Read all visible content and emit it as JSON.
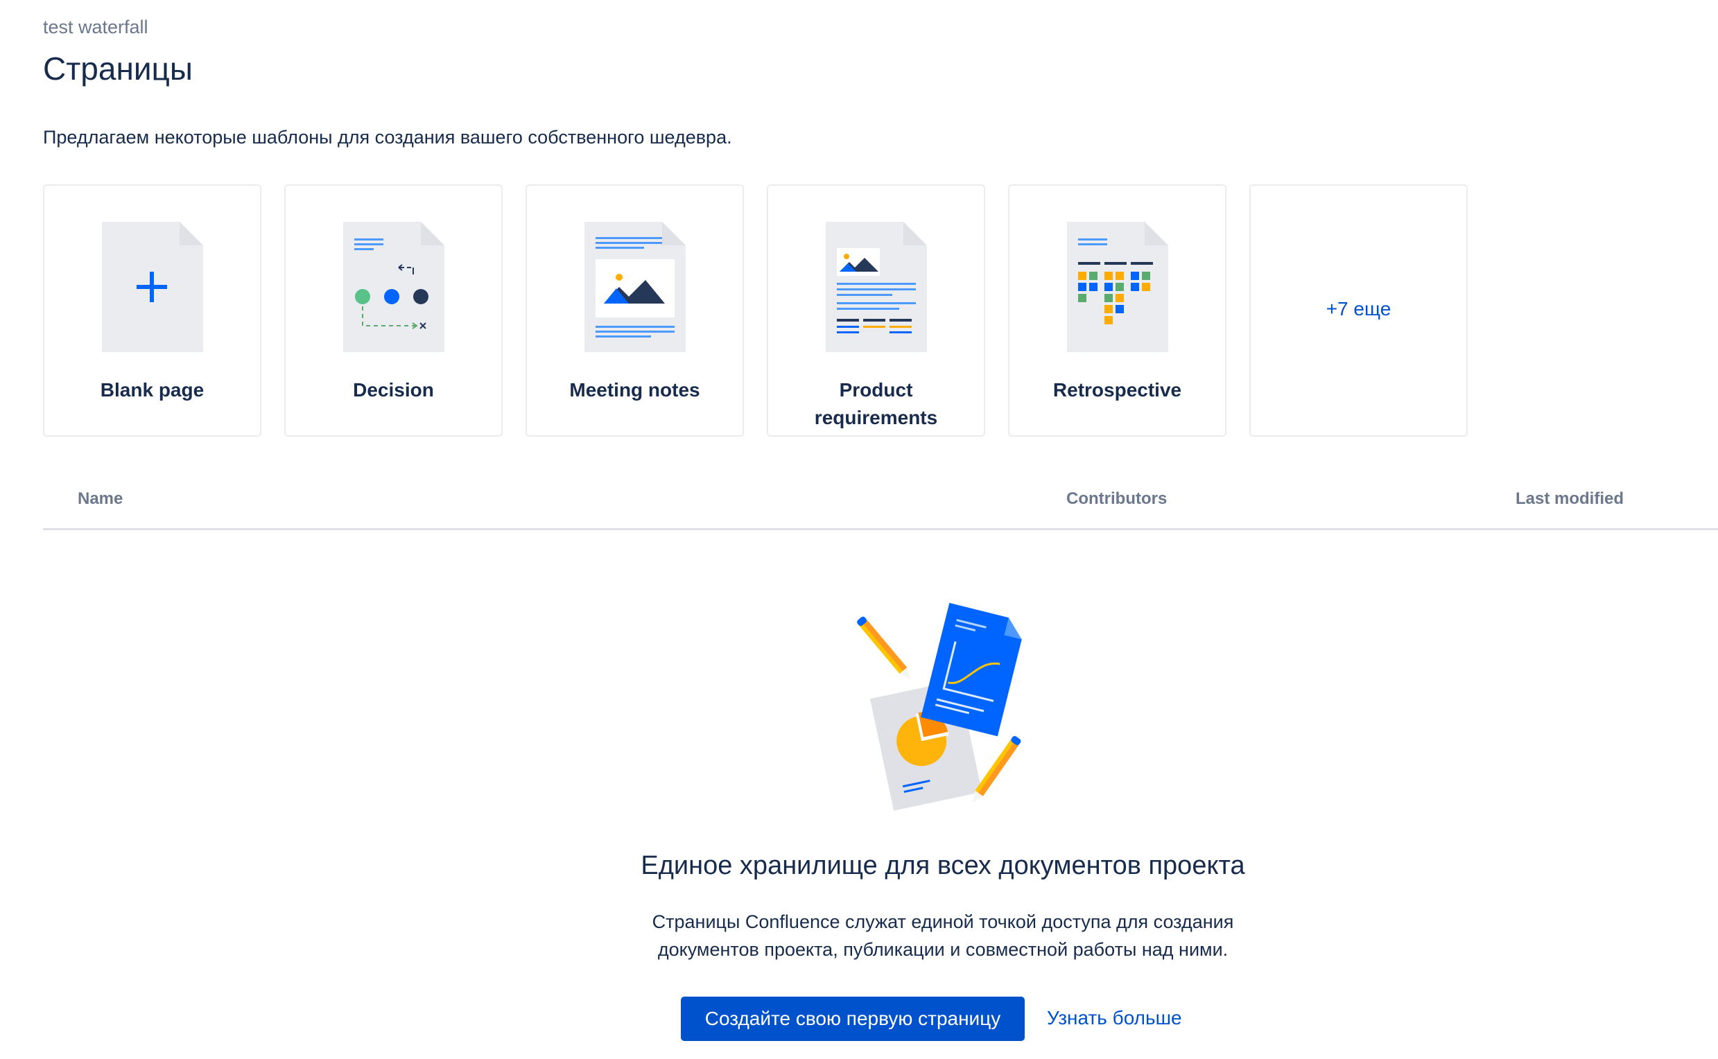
{
  "header": {
    "breadcrumb": "test waterfall",
    "title": "Страницы",
    "intro": "Предлагаем некоторые шаблоны для создания вашего собственного шедевра."
  },
  "templates": [
    {
      "label": "Blank page",
      "icon": "blank-page-icon"
    },
    {
      "label": "Decision",
      "icon": "decision-icon"
    },
    {
      "label": "Meeting notes",
      "icon": "meeting-notes-icon"
    },
    {
      "label": "Product requirements",
      "icon": "product-requirements-icon"
    },
    {
      "label": "Retrospective",
      "icon": "retrospective-icon"
    }
  ],
  "more_templates": "+7 еще",
  "table": {
    "columns": [
      "Name",
      "Contributors",
      "Last modified"
    ]
  },
  "empty_state": {
    "title": "Единое хранилище для всех документов проекта",
    "description_line1": "Страницы Confluence служат единой точкой доступа для создания",
    "description_line2": "документов проекта, публикации и совместной работы над ними.",
    "primary_button": "Создайте свою первую страницу",
    "secondary_link": "Узнать больше"
  },
  "colors": {
    "accent": "#0052cc",
    "text": "#172b4d",
    "muted": "#6b778c",
    "border": "#ebecf0"
  }
}
